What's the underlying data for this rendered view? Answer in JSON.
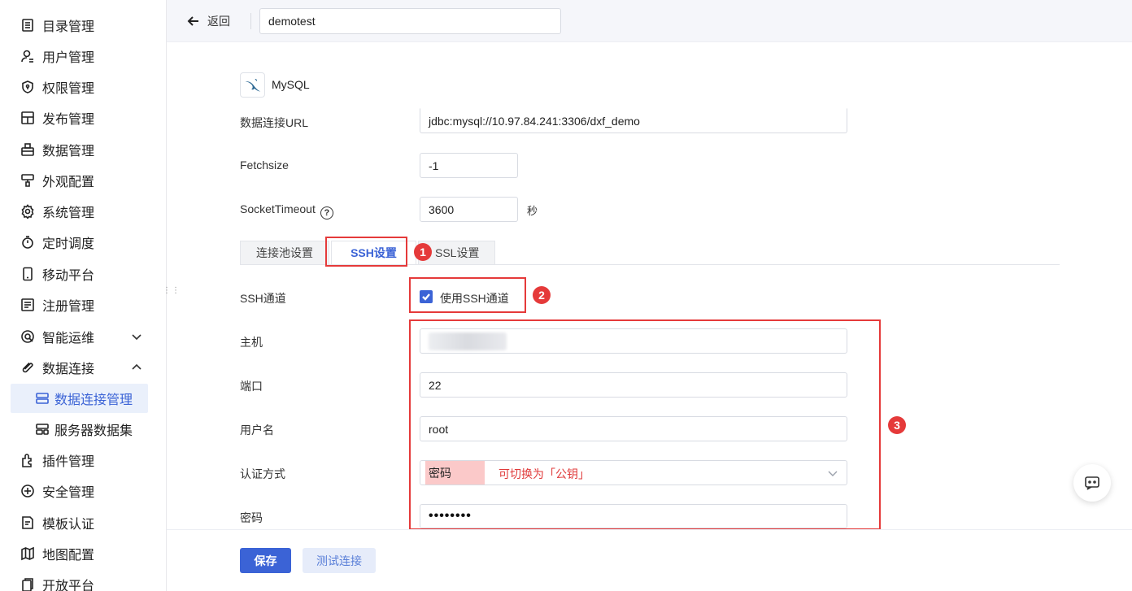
{
  "sidebar": {
    "items": [
      {
        "label": "目录管理",
        "icon": "catalog-icon"
      },
      {
        "label": "用户管理",
        "icon": "user-icon"
      },
      {
        "label": "权限管理",
        "icon": "shield-icon"
      },
      {
        "label": "发布管理",
        "icon": "publish-icon"
      },
      {
        "label": "数据管理",
        "icon": "data-icon"
      },
      {
        "label": "外观配置",
        "icon": "brush-icon"
      },
      {
        "label": "系统管理",
        "icon": "gear-icon"
      },
      {
        "label": "定时调度",
        "icon": "timer-icon"
      },
      {
        "label": "移动平台",
        "icon": "mobile-icon"
      },
      {
        "label": "注册管理",
        "icon": "register-icon"
      },
      {
        "label": "智能运维",
        "icon": "ops-icon"
      },
      {
        "label": "数据连接",
        "icon": "link-icon"
      },
      {
        "label": "插件管理",
        "icon": "plugin-icon"
      },
      {
        "label": "安全管理",
        "icon": "security-icon"
      },
      {
        "label": "模板认证",
        "icon": "template-icon"
      },
      {
        "label": "地图配置",
        "icon": "map-icon"
      },
      {
        "label": "开放平台",
        "icon": "open-icon"
      }
    ],
    "sub_items": [
      {
        "label": "数据连接管理",
        "icon": "server-icon",
        "active": true
      },
      {
        "label": "服务器数据集",
        "icon": "server-icon",
        "active": false
      }
    ]
  },
  "header": {
    "back_label": "返回",
    "connection_name": "demotest"
  },
  "db": {
    "type_name": "MySQL"
  },
  "form": {
    "url_label": "数据连接URL",
    "url_value": "jdbc:mysql://10.97.84.241:3306/dxf_demo",
    "fetchsize_label": "Fetchsize",
    "fetchsize_value": "-1",
    "socket_label": "SocketTimeout",
    "socket_help": "?",
    "socket_value": "3600",
    "socket_unit": "秒"
  },
  "tabs": [
    {
      "label": "连接池设置",
      "active": false
    },
    {
      "label": "SSH设置",
      "active": true
    },
    {
      "label": "SSL设置",
      "active": false
    }
  ],
  "ssh": {
    "channel_label": "SSH通道",
    "channel_checkbox_label": "使用SSH通道",
    "channel_checked": true,
    "host_label": "主机",
    "port_label": "端口",
    "port_value": "22",
    "user_label": "用户名",
    "user_value": "root",
    "auth_label": "认证方式",
    "auth_value": "密码",
    "auth_note": "可切换为「公钥」",
    "pwd_label": "密码",
    "pwd_value": "••••••••"
  },
  "annotations": [
    "1",
    "2",
    "3"
  ],
  "footer": {
    "save_label": "保存",
    "test_label": "测试连接"
  },
  "colors": {
    "primary": "#3b63d6",
    "annotation_red": "#e53a3a",
    "highlight_pink": "#fbc9c9"
  }
}
